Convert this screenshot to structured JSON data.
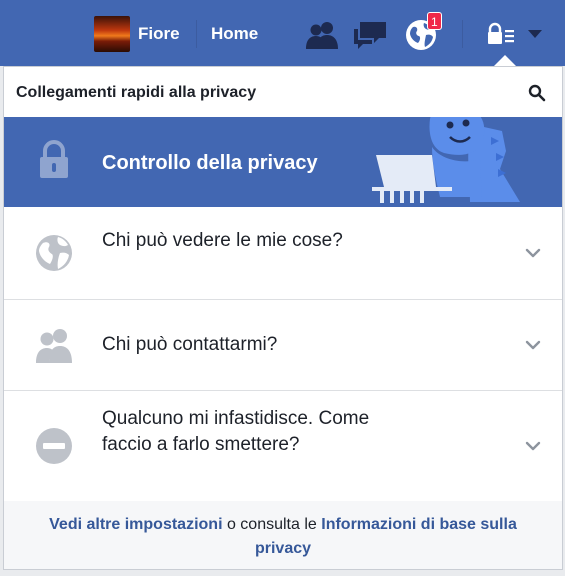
{
  "topbar": {
    "user_name": "Fiore",
    "home_label": "Home",
    "notification_count": "1",
    "icons": [
      "friends-icon",
      "messages-icon",
      "notifications-icon",
      "privacy-shortcut-icon",
      "dropdown-arrow-icon"
    ],
    "brand_color": "#4267b2",
    "badge_color": "#f02849"
  },
  "panel": {
    "title": "Collegamenti rapidi alla privacy",
    "checkup_label": "Controllo della privacy",
    "items": [
      {
        "label": "Chi può vedere le mie cose?",
        "icon": "globe-icon"
      },
      {
        "label": "Chi può contattarmi?",
        "icon": "people-icon"
      },
      {
        "label": "Qualcuno mi infastidisce. Come faccio a farlo smettere?",
        "icon": "block-icon"
      }
    ],
    "footer": {
      "link1": "Vedi altre impostazioni",
      "middle": " o consulta le ",
      "link2": "Informazioni di base sulla privacy"
    }
  }
}
